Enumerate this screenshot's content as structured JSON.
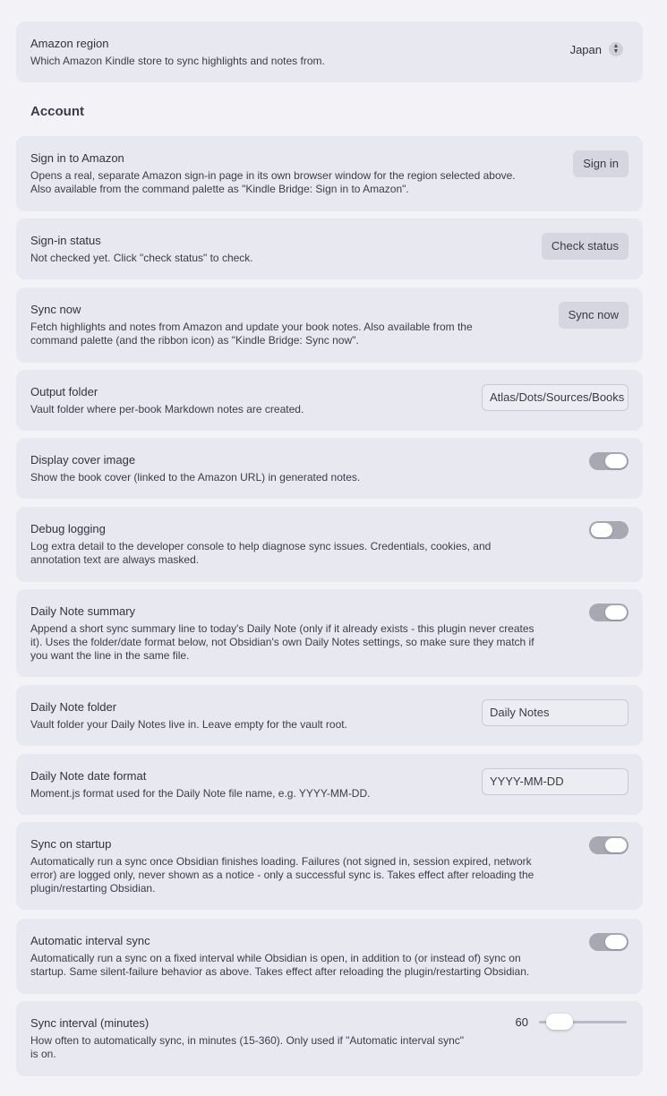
{
  "region": {
    "name": "Amazon region",
    "desc": "Which Amazon Kindle store to sync highlights and notes from.",
    "value": "Japan"
  },
  "section_account": "Account",
  "signin": {
    "name": "Sign in to Amazon",
    "desc1": "Opens a real, separate Amazon sign-in page in its own browser window for the region selected above.",
    "desc2": "Also available from the command palette as \"Kindle Bridge: Sign in to Amazon\".",
    "button": "Sign in"
  },
  "status": {
    "name": "Sign-in status",
    "desc": "Not checked yet. Click \"check status\" to check.",
    "button": "Check status"
  },
  "sync_now": {
    "name": "Sync now",
    "desc1": "Fetch highlights and notes from Amazon and update your book notes. Also available from the",
    "desc2": "command palette (and the ribbon icon) as \"Kindle Bridge: Sync now\".",
    "button": "Sync now"
  },
  "output_folder": {
    "name": "Output folder",
    "desc": "Vault folder where per-book Markdown notes are created.",
    "value": "Atlas/Dots/Sources/Books"
  },
  "cover": {
    "name": "Display cover image",
    "desc": "Show the book cover (linked to the Amazon URL) in generated notes.",
    "enabled": true
  },
  "debug": {
    "name": "Debug logging",
    "desc1": "Log extra detail to the developer console to help diagnose sync issues. Credentials, cookies, and",
    "desc2": "annotation text are always masked.",
    "enabled": false
  },
  "daily_summary": {
    "name": "Daily Note summary",
    "desc1": "Append a short sync summary line to today's Daily Note (only if it already exists - this plugin never creates",
    "desc2": "it). Uses the folder/date format below, not Obsidian's own Daily Notes settings, so make sure they match if",
    "desc3": "you want the line in the same file.",
    "enabled": true
  },
  "daily_folder": {
    "name": "Daily Note folder",
    "desc": "Vault folder your Daily Notes live in. Leave empty for the vault root.",
    "value": "Daily Notes"
  },
  "daily_format": {
    "name": "Daily Note date format",
    "desc": "Moment.js format used for the Daily Note file name, e.g. YYYY-MM-DD.",
    "value": "YYYY-MM-DD"
  },
  "startup": {
    "name": "Sync on startup",
    "desc1": "Automatically run a sync once Obsidian finishes loading. Failures (not signed in, session expired, network",
    "desc2": "error) are logged only, never shown as a notice - only a successful sync is. Takes effect after reloading the",
    "desc3": "plugin/restarting Obsidian.",
    "enabled": true
  },
  "interval_sync": {
    "name": "Automatic interval sync",
    "desc1": "Automatically run a sync on a fixed interval while Obsidian is open, in addition to (or instead of) sync on",
    "desc2": "startup. Same silent-failure behavior as above. Takes effect after reloading the plugin/restarting Obsidian.",
    "enabled": true
  },
  "interval": {
    "name": "Sync interval (minutes)",
    "desc1": "How often to automatically sync, in minutes (15-360). Only used if \"Automatic interval sync\"",
    "desc2": "is on.",
    "value": "60"
  }
}
